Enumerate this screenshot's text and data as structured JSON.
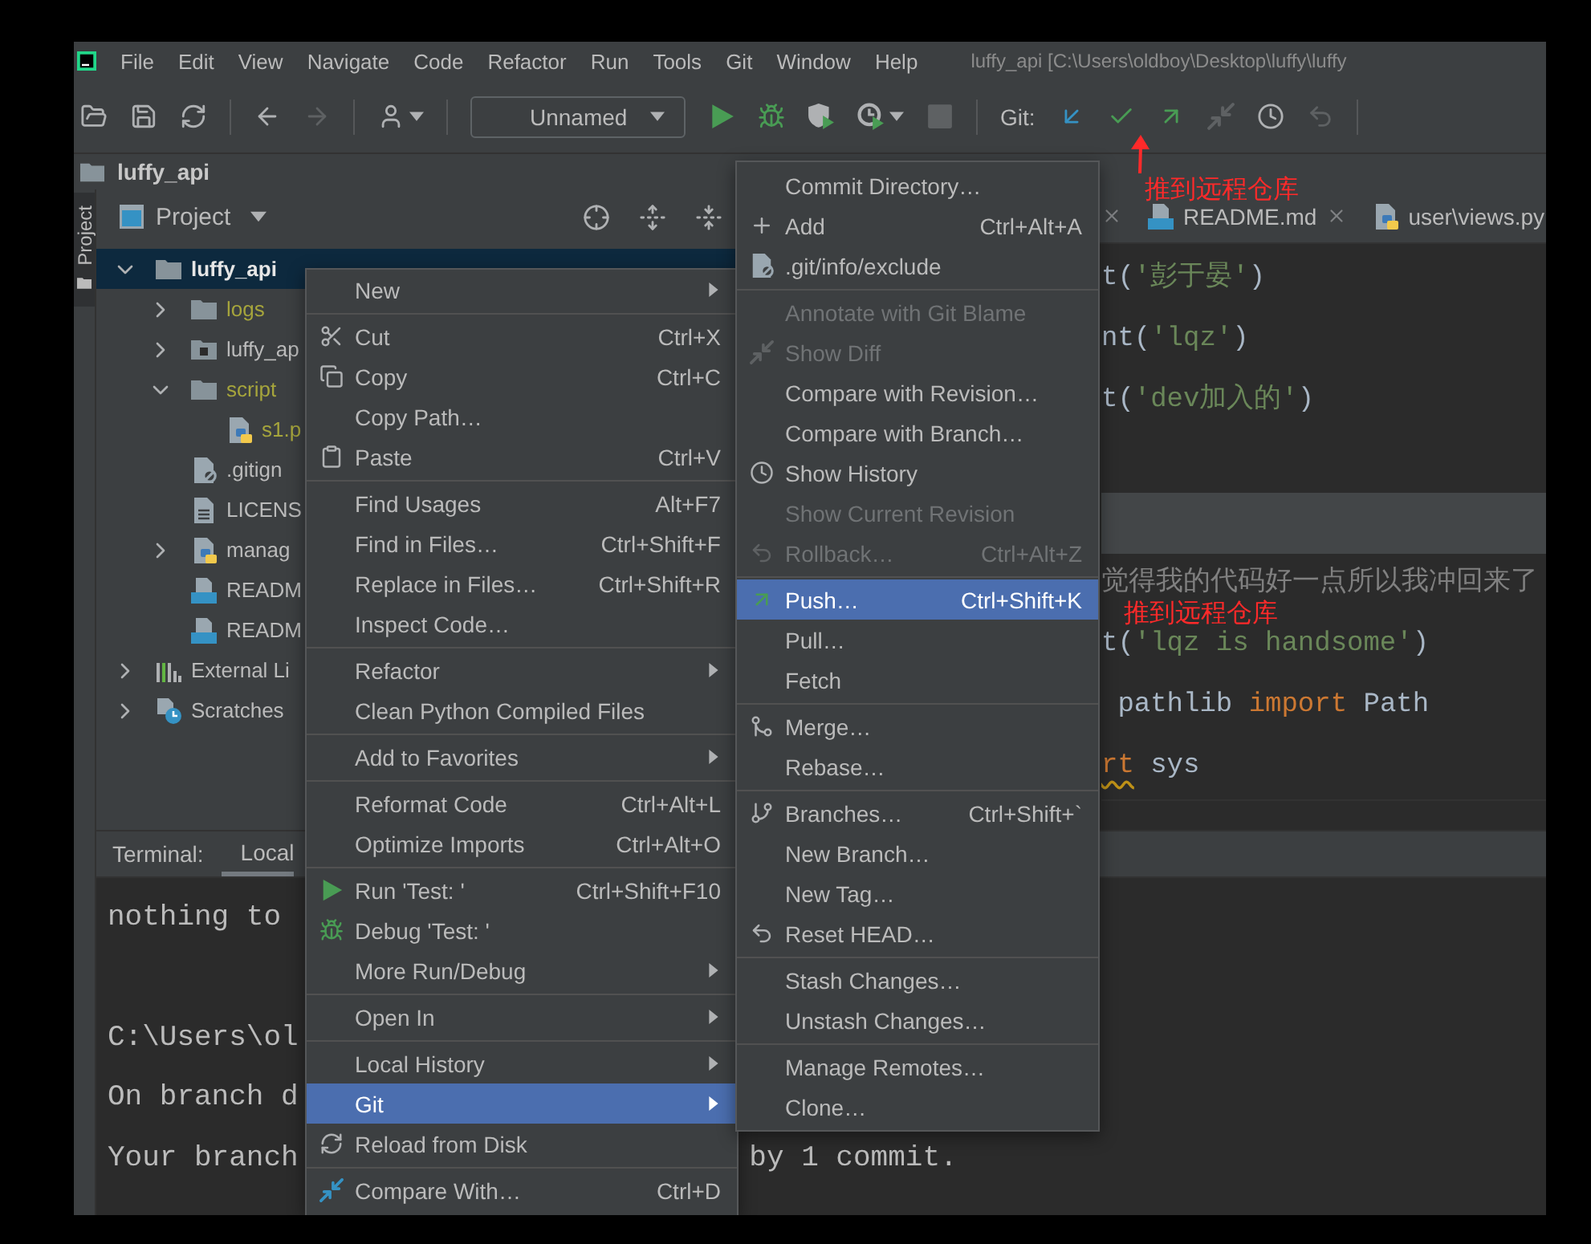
{
  "menu_bar": {
    "items": [
      "File",
      "Edit",
      "View",
      "Navigate",
      "Code",
      "Refactor",
      "Run",
      "Tools",
      "Git",
      "Window",
      "Help"
    ]
  },
  "window": {
    "title": "luffy_api [C:\\Users\\oldboy\\Desktop\\luffy\\luffy"
  },
  "toolbar": {
    "buttons": [
      {
        "kind": "open",
        "disabled": false
      },
      {
        "kind": "save",
        "disabled": false
      },
      {
        "kind": "sync",
        "disabled": false
      },
      {
        "kind": "separator"
      },
      {
        "kind": "back",
        "disabled": false
      },
      {
        "kind": "forward",
        "disabled": true
      },
      {
        "kind": "separator"
      },
      {
        "kind": "user",
        "disabled": false
      },
      {
        "kind": "separator"
      },
      {
        "kind": "run-config",
        "label": "Unnamed"
      },
      {
        "kind": "run",
        "disabled": false
      },
      {
        "kind": "debug",
        "disabled": false
      },
      {
        "kind": "coverage",
        "disabled": false
      },
      {
        "kind": "profile",
        "disabled": false
      },
      {
        "kind": "stop",
        "disabled": true
      },
      {
        "kind": "separator"
      },
      {
        "kind": "label",
        "label": "Git:"
      },
      {
        "kind": "update",
        "disabled": false
      },
      {
        "kind": "commit",
        "disabled": false
      },
      {
        "kind": "push",
        "disabled": false
      },
      {
        "kind": "diff",
        "disabled": true
      },
      {
        "kind": "history",
        "disabled": false
      },
      {
        "kind": "rollback",
        "disabled": true
      },
      {
        "kind": "separator"
      }
    ]
  },
  "navigation_bar": {
    "crumbs": [
      "luffy_api"
    ]
  },
  "tool_stripe": {
    "tabs": [
      {
        "label": "Project",
        "selected": true
      }
    ]
  },
  "project_panel": {
    "title": "Project",
    "tree": [
      {
        "label": "luffy_api",
        "kind": "project",
        "expanded": true,
        "selected": true,
        "ignored": false,
        "children": [
          {
            "label": "logs",
            "kind": "folder",
            "expanded": false,
            "selected": false,
            "ignored": true
          },
          {
            "label": "luffy_ap",
            "kind": "module",
            "expanded": false,
            "selected": false,
            "ignored": false
          },
          {
            "label": "script",
            "kind": "folder",
            "expanded": true,
            "selected": false,
            "ignored": true,
            "children": [
              {
                "label": "s1.p",
                "kind": "python",
                "selected": false,
                "ignored": true
              }
            ]
          },
          {
            "label": ".gitign",
            "kind": "gitignore",
            "selected": false,
            "ignored": false
          },
          {
            "label": "LICENS",
            "kind": "text",
            "selected": false,
            "ignored": false
          },
          {
            "label": "manag",
            "kind": "python",
            "expanded": false,
            "selected": false,
            "ignored": false
          },
          {
            "label": "READM",
            "kind": "markdown",
            "selected": false,
            "ignored": false
          },
          {
            "label": "READM",
            "kind": "markdown",
            "selected": false,
            "ignored": false
          }
        ]
      },
      {
        "label": "External Li",
        "kind": "libraries",
        "expanded": false,
        "selected": false,
        "ignored": false
      },
      {
        "label": "Scratches",
        "kind": "scratches",
        "expanded": false,
        "selected": false,
        "ignored": false
      }
    ]
  },
  "editor": {
    "tabs": [
      {
        "label": "README.md",
        "kind": "markdown"
      },
      {
        "label": "user\\views.py",
        "kind": "python"
      }
    ],
    "lines": [
      {
        "current": false,
        "tokens": [
          {
            "text": "t(",
            "kind": "plain"
          },
          {
            "text": "'彭于晏'",
            "kind": "string"
          },
          {
            "text": ")",
            "kind": "plain"
          }
        ]
      },
      {
        "current": false,
        "tokens": [
          {
            "text": "nt(",
            "kind": "plain"
          },
          {
            "text": "'lqz'",
            "kind": "string"
          },
          {
            "text": ")",
            "kind": "plain"
          }
        ]
      },
      {
        "current": false,
        "tokens": [
          {
            "text": "t(",
            "kind": "plain"
          },
          {
            "text": "'dev加入的'",
            "kind": "string"
          },
          {
            "text": ")",
            "kind": "plain"
          }
        ]
      },
      {
        "current": false
      },
      {
        "current": true
      },
      {
        "current": false,
        "tokens": [
          {
            "text": "觉得我的代码好一点所以我冲回来了",
            "kind": "comment"
          }
        ]
      },
      {
        "current": false,
        "tokens": [
          {
            "text": "t(",
            "kind": "plain"
          },
          {
            "text": "'lqz is handsome'",
            "kind": "string"
          },
          {
            "text": ")",
            "kind": "plain"
          }
        ]
      },
      {
        "current": false,
        "tokens": [
          {
            "text": " pathlib ",
            "kind": "plain"
          },
          {
            "text": "import",
            "kind": "keyword"
          },
          {
            "text": " Path",
            "kind": "plain"
          }
        ]
      },
      {
        "current": false,
        "tokens": [
          {
            "text": "rt",
            "kind": "flagged"
          },
          {
            "text": " sys",
            "kind": "plain"
          }
        ]
      }
    ]
  },
  "terminal": {
    "title": "Terminal:",
    "tabs": [
      {
        "label": "Local",
        "selected": true
      }
    ],
    "blocks": [
      {
        "lines": [
          {
            "segments": [
              "nothing to"
            ]
          }
        ]
      },
      {
        "lines": [
          {
            "segments": [
              "C:\\Users\\ol"
            ]
          },
          {
            "segments": [
              "On branch d"
            ]
          },
          {
            "segments": [
              "Your branch",
              "by 1 commit."
            ]
          }
        ]
      }
    ]
  },
  "context_menu": {
    "items": [
      {
        "label": "New",
        "kind": "plain",
        "submenu": true,
        "selected": false
      },
      {
        "kind": "separator"
      },
      {
        "label": "Cut",
        "kind": "cut",
        "shortcut": "Ctrl+X",
        "submenu": false,
        "selected": false
      },
      {
        "label": "Copy",
        "kind": "copy",
        "shortcut": "Ctrl+C",
        "submenu": false,
        "selected": false
      },
      {
        "label": "Copy Path…",
        "kind": "plain",
        "submenu": false,
        "selected": false
      },
      {
        "label": "Paste",
        "kind": "paste",
        "shortcut": "Ctrl+V",
        "submenu": false,
        "selected": false
      },
      {
        "kind": "separator"
      },
      {
        "label": "Find Usages",
        "kind": "plain",
        "shortcut": "Alt+F7",
        "submenu": false,
        "selected": false
      },
      {
        "label": "Find in Files…",
        "kind": "plain",
        "shortcut": "Ctrl+Shift+F",
        "submenu": false,
        "selected": false
      },
      {
        "label": "Replace in Files…",
        "kind": "plain",
        "shortcut": "Ctrl+Shift+R",
        "submenu": false,
        "selected": false
      },
      {
        "label": "Inspect Code…",
        "kind": "plain",
        "submenu": false,
        "selected": false
      },
      {
        "kind": "separator"
      },
      {
        "label": "Refactor",
        "kind": "plain",
        "submenu": true,
        "selected": false
      },
      {
        "label": "Clean Python Compiled Files",
        "kind": "plain",
        "submenu": false,
        "selected": false
      },
      {
        "kind": "separator"
      },
      {
        "label": "Add to Favorites",
        "kind": "plain",
        "submenu": true,
        "selected": false
      },
      {
        "kind": "separator"
      },
      {
        "label": "Reformat Code",
        "kind": "plain",
        "shortcut": "Ctrl+Alt+L",
        "submenu": false,
        "selected": false
      },
      {
        "label": "Optimize Imports",
        "kind": "plain",
        "shortcut": "Ctrl+Alt+O",
        "submenu": false,
        "selected": false
      },
      {
        "kind": "separator"
      },
      {
        "label": "Run 'Test: '",
        "kind": "run",
        "shortcut": "Ctrl+Shift+F10",
        "submenu": false,
        "selected": false
      },
      {
        "label": "Debug 'Test: '",
        "kind": "debug",
        "submenu": false,
        "selected": false
      },
      {
        "label": "More Run/Debug",
        "kind": "plain",
        "submenu": true,
        "selected": false
      },
      {
        "kind": "separator"
      },
      {
        "label": "Open In",
        "kind": "plain",
        "submenu": true,
        "selected": false
      },
      {
        "kind": "separator"
      },
      {
        "label": "Local History",
        "kind": "plain",
        "submenu": true,
        "selected": false
      },
      {
        "label": "Git",
        "kind": "plain",
        "submenu": true,
        "selected": true
      },
      {
        "label": "Reload from Disk",
        "kind": "reload",
        "submenu": false,
        "selected": false
      },
      {
        "kind": "separator"
      },
      {
        "label": "Compare With…",
        "kind": "compare",
        "shortcut": "Ctrl+D",
        "submenu": false,
        "selected": false
      }
    ]
  },
  "git_submenu": {
    "items": [
      {
        "label": "Commit Directory…",
        "kind": "plain",
        "disabled": false,
        "selected": false
      },
      {
        "label": "Add",
        "kind": "add",
        "shortcut": "Ctrl+Alt+A",
        "disabled": false,
        "selected": false
      },
      {
        "label": ".git/info/exclude",
        "kind": "exclude",
        "disabled": false,
        "selected": false
      },
      {
        "kind": "separator"
      },
      {
        "label": "Annotate with Git Blame",
        "kind": "plain",
        "disabled": true,
        "selected": false
      },
      {
        "label": "Show Diff",
        "kind": "diff",
        "disabled": true,
        "selected": false
      },
      {
        "label": "Compare with Revision…",
        "kind": "plain",
        "disabled": false,
        "selected": false
      },
      {
        "label": "Compare with Branch…",
        "kind": "plain",
        "disabled": false,
        "selected": false
      },
      {
        "label": "Show History",
        "kind": "history",
        "disabled": false,
        "selected": false
      },
      {
        "label": "Show Current Revision",
        "kind": "plain",
        "disabled": true,
        "selected": false
      },
      {
        "label": "Rollback…",
        "kind": "rollback",
        "shortcut": "Ctrl+Alt+Z",
        "disabled": true,
        "selected": false
      },
      {
        "kind": "separator"
      },
      {
        "label": "Push…",
        "kind": "push",
        "shortcut": "Ctrl+Shift+K",
        "disabled": false,
        "selected": true
      },
      {
        "label": "Pull…",
        "kind": "plain",
        "disabled": false,
        "selected": false
      },
      {
        "label": "Fetch",
        "kind": "plain",
        "disabled": false,
        "selected": false
      },
      {
        "kind": "separator"
      },
      {
        "label": "Merge…",
        "kind": "merge",
        "disabled": false,
        "selected": false
      },
      {
        "label": "Rebase…",
        "kind": "plain",
        "disabled": false,
        "selected": false
      },
      {
        "kind": "separator"
      },
      {
        "label": "Branches…",
        "kind": "branches",
        "shortcut": "Ctrl+Shift+`",
        "disabled": false,
        "selected": false
      },
      {
        "label": "New Branch…",
        "kind": "plain",
        "disabled": false,
        "selected": false
      },
      {
        "label": "New Tag…",
        "kind": "plain",
        "disabled": false,
        "selected": false
      },
      {
        "label": "Reset HEAD…",
        "kind": "reset",
        "disabled": false,
        "selected": false
      },
      {
        "kind": "separator"
      },
      {
        "label": "Stash Changes…",
        "kind": "plain",
        "disabled": false,
        "selected": false
      },
      {
        "label": "Unstash Changes…",
        "kind": "plain",
        "disabled": false,
        "selected": false
      },
      {
        "kind": "separator"
      },
      {
        "label": "Manage Remotes…",
        "kind": "plain",
        "disabled": false,
        "selected": false
      },
      {
        "label": "Clone…",
        "kind": "plain",
        "disabled": false,
        "selected": false
      }
    ]
  },
  "annotations": [
    {
      "kind": "arrow-label",
      "text": "推到远程仓库"
    },
    {
      "kind": "label",
      "text": "推到远程仓库"
    }
  ]
}
